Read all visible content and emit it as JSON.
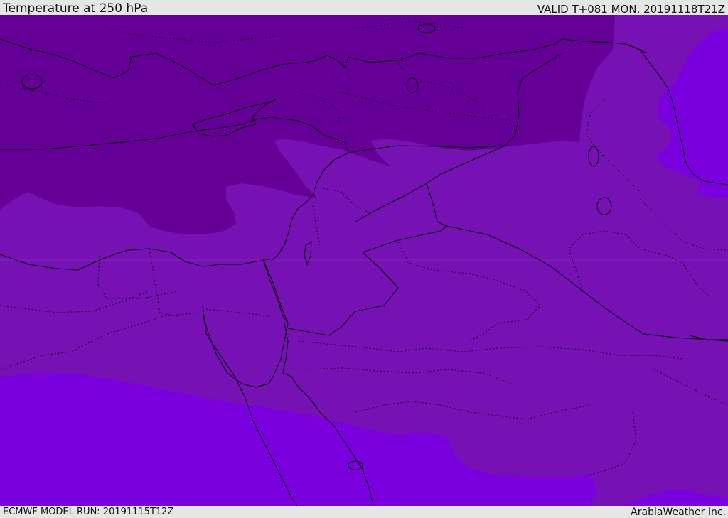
{
  "header": {
    "title": "Temperature at 250 hPa",
    "valid": "VALID T+081 MON. 20191118T21Z"
  },
  "footer": {
    "model_run": "ECMWF MODEL RUN: 20191115T12Z",
    "credit": "ArabiaWeather Inc."
  },
  "map": {
    "colors": {
      "cold_band": "#650097",
      "mid_band": "#7611b4",
      "warm_band": "#7a00dd",
      "border_line": "#000000"
    }
  }
}
